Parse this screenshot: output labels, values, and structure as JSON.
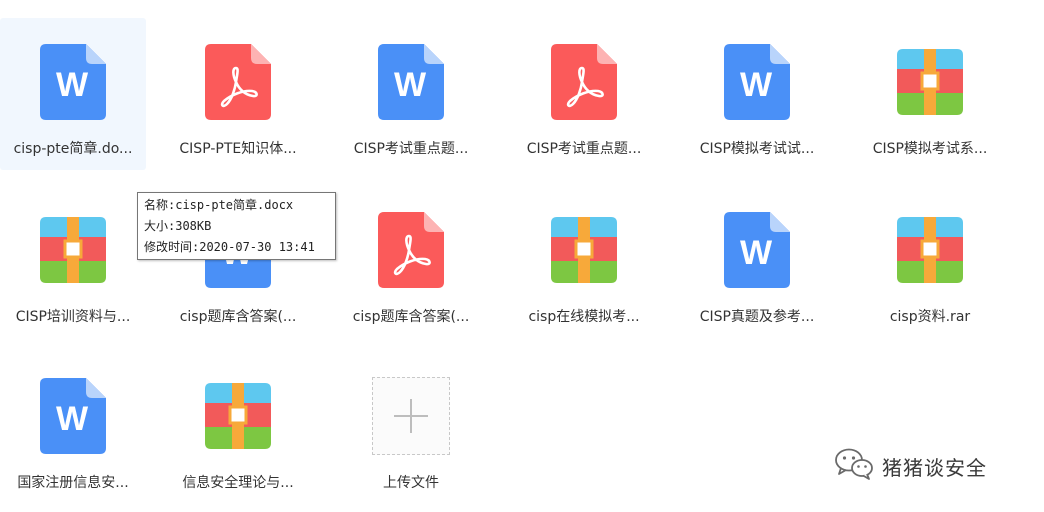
{
  "files": [
    {
      "type": "doc",
      "label": "cisp-pte简章.do..."
    },
    {
      "type": "pdf",
      "label": "CISP-PTE知识体..."
    },
    {
      "type": "doc",
      "label": "CISP考试重点题..."
    },
    {
      "type": "pdf",
      "label": "CISP考试重点题..."
    },
    {
      "type": "doc",
      "label": "CISP模拟考试试..."
    },
    {
      "type": "rar",
      "label": "CISP模拟考试系..."
    },
    {
      "type": "rar",
      "label": "CISP培训资料与..."
    },
    {
      "type": "doc",
      "label": "cisp题库含答案(..."
    },
    {
      "type": "pdf",
      "label": "cisp题库含答案(..."
    },
    {
      "type": "rar",
      "label": "cisp在线模拟考..."
    },
    {
      "type": "doc",
      "label": "CISP真题及参考..."
    },
    {
      "type": "rar",
      "label": "cisp资料.rar"
    },
    {
      "type": "doc",
      "label": "国家注册信息安..."
    },
    {
      "type": "rar",
      "label": "信息安全理论与..."
    }
  ],
  "upload": {
    "label": "上传文件",
    "icon": "plus-icon"
  },
  "tooltip": {
    "name_line": "名称:cisp-pte简章.docx",
    "size_line": "大小:308KB",
    "mtime_line": "修改时间:2020-07-30 13:41"
  },
  "watermark": {
    "text": "猪猪谈安全",
    "icon": "wechat-icon"
  },
  "colors": {
    "doc_blue": "#4a90f7",
    "pdf_red": "#fb5a5a",
    "rar_cyan": "#5ec8ef",
    "rar_red": "#f25a5a",
    "rar_green": "#7dc742",
    "rar_orange": "#f7a93a",
    "selected_bg": "#f1f7fe"
  }
}
